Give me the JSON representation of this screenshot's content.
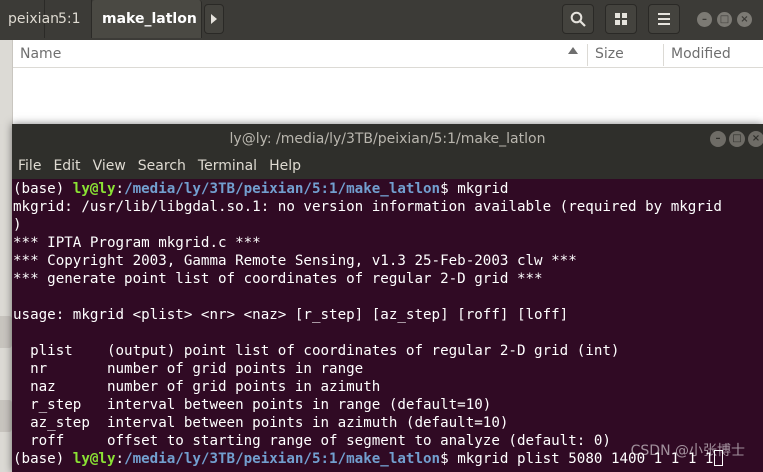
{
  "file_manager": {
    "tabs": [
      {
        "label": "peixian",
        "active": false
      },
      {
        "label": "5:1",
        "active": false
      },
      {
        "label": "make_latlon",
        "active": true
      }
    ],
    "columns": {
      "name": "Name",
      "size": "Size",
      "modified": "Modified"
    },
    "icons": {
      "tab_scroll": "chevron-right-icon",
      "search": "search-icon",
      "view": "grid-view-icon",
      "menu": "hamburger-menu-icon",
      "minimize": "minimize-icon",
      "maximize": "maximize-icon",
      "close": "close-icon"
    }
  },
  "terminal": {
    "title": "ly@ly: /media/ly/3TB/peixian/5:1/make_latlon",
    "menu": [
      "File",
      "Edit",
      "View",
      "Search",
      "Terminal",
      "Help"
    ],
    "prompt": {
      "env": "(base) ",
      "user_host": "ly@ly",
      "sep": ":",
      "path": "/media/ly/3TB/peixian/5:1/make_latlon",
      "symbol": "$ "
    },
    "commands": [
      "mkgrid",
      "mkgrid plist 5080 1400 1 1 1 1"
    ],
    "output": [
      "mkgrid: /usr/lib/libgdal.so.1: no version information available (required by mkgrid",
      ")",
      "*** IPTA Program mkgrid.c ***",
      "*** Copyright 2003, Gamma Remote Sensing, v1.3 25-Feb-2003 clw ***",
      "*** generate point list of coordinates of regular 2-D grid ***",
      "",
      "usage: mkgrid <plist> <nr> <naz> [r_step] [az_step] [roff] [loff]",
      "",
      "  plist    (output) point list of coordinates of regular 2-D grid (int)",
      "  nr       number of grid points in range",
      "  naz      number of grid points in azimuth",
      "  r_step   interval between points in range (default=10)",
      "  az_step  interval between points in azimuth (default=10)",
      "  roff     offset to starting range of segment to analyze (default: 0)"
    ],
    "watermark": "CSDN @小张博士",
    "colors": {
      "background": "#300a24",
      "user_host": "#8ae234",
      "path": "#729fcf",
      "text": "#ffffff"
    }
  }
}
